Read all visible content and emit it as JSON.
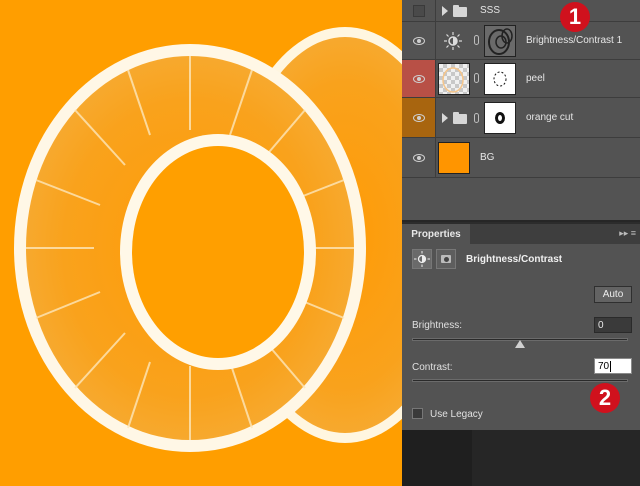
{
  "layers": [
    {
      "name": "SSS",
      "type": "group",
      "visible": false
    },
    {
      "name": "Brightness/Contrast 1",
      "type": "adjustment",
      "visible": true
    },
    {
      "name": "peel",
      "type": "layer",
      "visible": true,
      "label_color": "#b85046"
    },
    {
      "name": "orange cut",
      "type": "group",
      "visible": true,
      "label_color": "#a8650f"
    },
    {
      "name": "BG",
      "type": "fill",
      "visible": true,
      "fill_color": "#ff9500"
    }
  ],
  "properties": {
    "tab_label": "Properties",
    "menu_icons": "▸▸ ≡",
    "panel_title": "Brightness/Contrast",
    "auto_label": "Auto",
    "brightness_label": "Brightness:",
    "brightness_value": "0",
    "brightness_level": 0,
    "brightness_range": [
      -150,
      150
    ],
    "contrast_label": "Contrast:",
    "contrast_value": "70",
    "use_legacy_label": "Use Legacy",
    "use_legacy_checked": false
  },
  "annotations": [
    {
      "number": "1",
      "color": "#d0111d"
    },
    {
      "number": "2",
      "color": "#d0111d"
    }
  ],
  "canvas": {
    "background": "#ff9e00",
    "subject": "orange-slice-letter-o"
  }
}
